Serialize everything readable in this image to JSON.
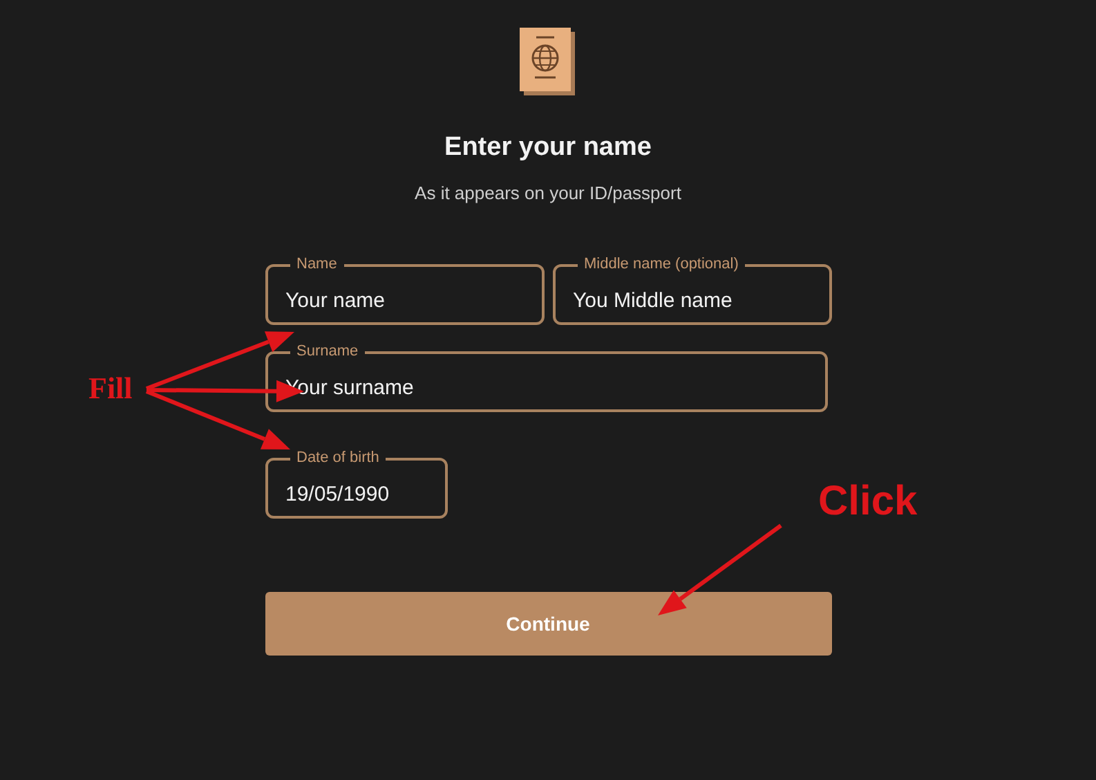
{
  "header": {
    "title": "Enter your name",
    "subtitle": "As it appears on your ID/passport"
  },
  "fields": [
    {
      "label": "Name",
      "value": "Your name"
    },
    {
      "label": "Middle name (optional)",
      "value": "You Middle name"
    },
    {
      "label": "Surname",
      "value": "Your surname"
    },
    {
      "label": "Date of birth",
      "value": "19/05/1990"
    }
  ],
  "button": {
    "label": "Continue"
  },
  "annotations": [
    {
      "kind": "fill",
      "text": "Fill"
    },
    {
      "kind": "click",
      "text": "Click"
    }
  ]
}
